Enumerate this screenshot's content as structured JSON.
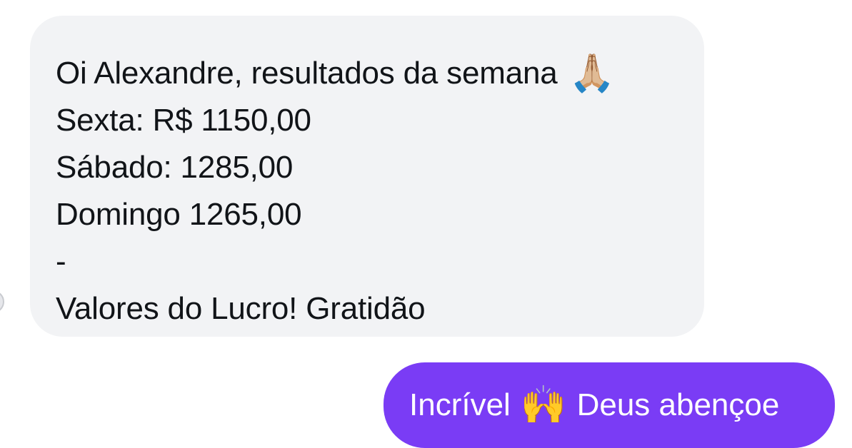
{
  "messages": {
    "received": {
      "greeting_text": "Oi Alexandre, resultados da semana",
      "greeting_emoji": "🙏🏼",
      "lines": [
        "Sexta: R$ 1150,00",
        "Sábado: 1285,00",
        "Domingo 1265,00",
        "-",
        "Valores do Lucro! Gratidão"
      ]
    },
    "sent": {
      "text_before": "Incrível",
      "emoji": "🙌",
      "text_after": "Deus abençoe"
    }
  },
  "colors": {
    "received_bubble": "#f2f3f5",
    "sent_bubble": "#7a3cf5",
    "text_dark": "#111418",
    "text_light": "#ffffff"
  },
  "icons": {
    "received_emoji": "folded-hands-icon",
    "sent_emoji": "raising-hands-icon"
  }
}
